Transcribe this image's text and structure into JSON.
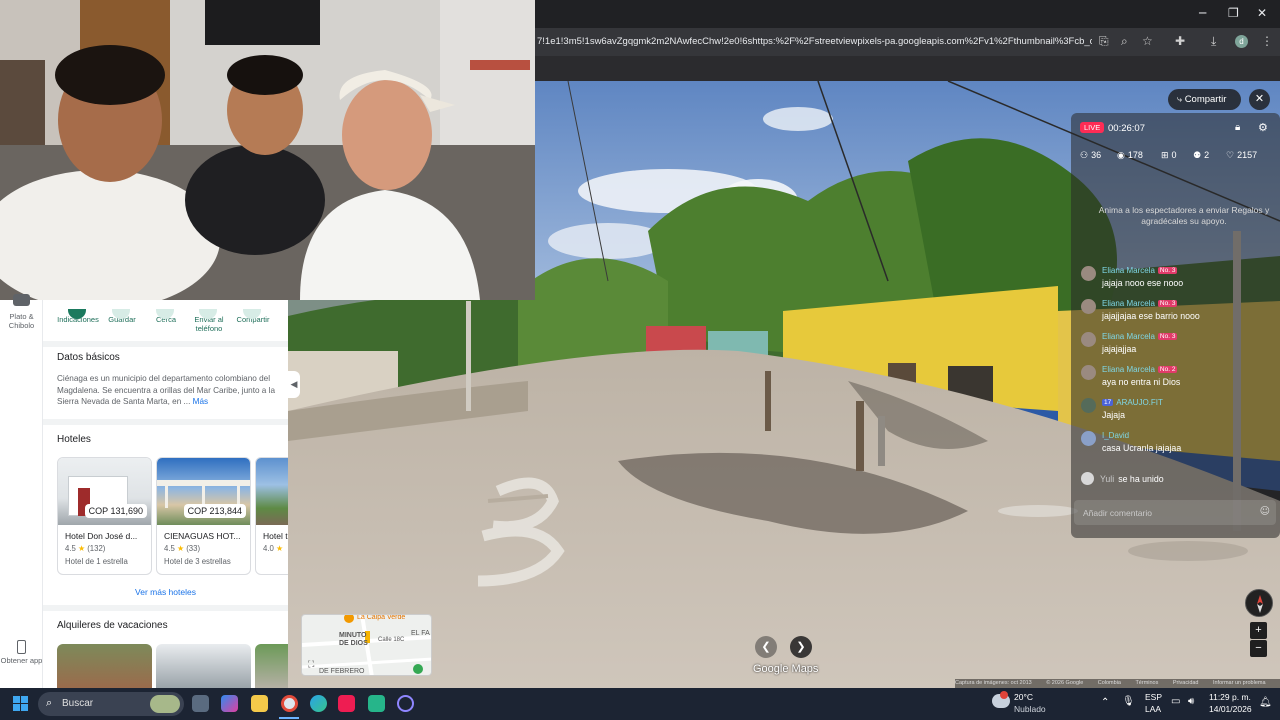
{
  "browser": {
    "url": "7!1e1!3m5!1sw6avZgqgmk2m2NAwfecChw!2e0!6shttps:%2F%2Fstreetviewpixels-pa.googleapis.com%2Fv1%2Fthumbnail%3Fcb_clie..."
  },
  "rail": {
    "plate_label": "Plato & Chibolo",
    "get_app_label": "Obtener app"
  },
  "place_actions": [
    {
      "label": "Indicaciones"
    },
    {
      "label": "Guardar"
    },
    {
      "label": "Cerca"
    },
    {
      "label": "Enviar al teléfono"
    },
    {
      "label": "Compartir"
    }
  ],
  "basics": {
    "title": "Datos básicos",
    "description": "Ciénaga es un municipio del departamento colombiano del Magdalena. Se encuentra a orillas del Mar Caribe, junto a la Sierra Nevada de Santa Marta, en ...",
    "more_link": "Más"
  },
  "hotels": {
    "title": "Hoteles",
    "items": [
      {
        "price": "COP 131,690",
        "name": "Hotel Don José d...",
        "rating": "4.5",
        "reviews": "(132)",
        "class": "Hotel de 1 estrella"
      },
      {
        "price": "COP 213,844",
        "name": "CIENAGUAS HOT...",
        "rating": "4.5",
        "reviews": "(33)",
        "class": "Hotel de 3 estrellas"
      },
      {
        "price": "",
        "name": "Hotel t",
        "rating": "4.0",
        "reviews": "",
        "class": ""
      }
    ],
    "more": "Ver más hoteles"
  },
  "rentals": {
    "title": "Alquileres de vacaciones"
  },
  "streetview": {
    "share_label": "Compartir",
    "logo": "Google Maps",
    "minimap_labels": [
      "La Calpa Verde",
      "MINUTO DE DIOS",
      "EL FA",
      "Calle 18C",
      "DE FEBRERO"
    ],
    "footer": [
      "Captura de imágenes: oct 2013",
      "© 2026 Google",
      "Colombia",
      "Términos",
      "Privacidad",
      "Informar un problema"
    ]
  },
  "live": {
    "badge": "LIVE",
    "time": "00:26:07",
    "stats": {
      "viewers": "36",
      "views": "178",
      "gifts": "0",
      "joined": "2",
      "likes": "2157"
    },
    "encourage": "Anima a los espectadores a enviar Regalos y agradécales su apoyo.",
    "messages": [
      {
        "user": "Eliana Marcela",
        "badge": "No. 3",
        "text": "jajaja nooo ese nooo"
      },
      {
        "user": "Eliana Marcela",
        "badge": "No. 3",
        "text": "jajajjajaa ese barrio nooo"
      },
      {
        "user": "Eliana Marcela",
        "badge": "No. 3",
        "text": "jajajajjaa"
      },
      {
        "user": "Eliana Marcela",
        "badge": "No. 2",
        "text": "aya no entra ni Dios"
      },
      {
        "user": "ARAUJO.FIT",
        "badge": "17",
        "text": "Jajaja"
      },
      {
        "user": "I_David",
        "badge": "",
        "text": "casa Ucranla jajajaa"
      }
    ],
    "join": {
      "user": "Yuli",
      "text": "se ha unido"
    },
    "comment_placeholder": "Añadir comentario"
  },
  "taskbar": {
    "search_label": "Buscar",
    "weather_temp": "20°C",
    "weather_desc": "Nublado",
    "language": "ESP",
    "layout": "LAA",
    "time": "11:29 p. m.",
    "date": "14/01/2026"
  }
}
